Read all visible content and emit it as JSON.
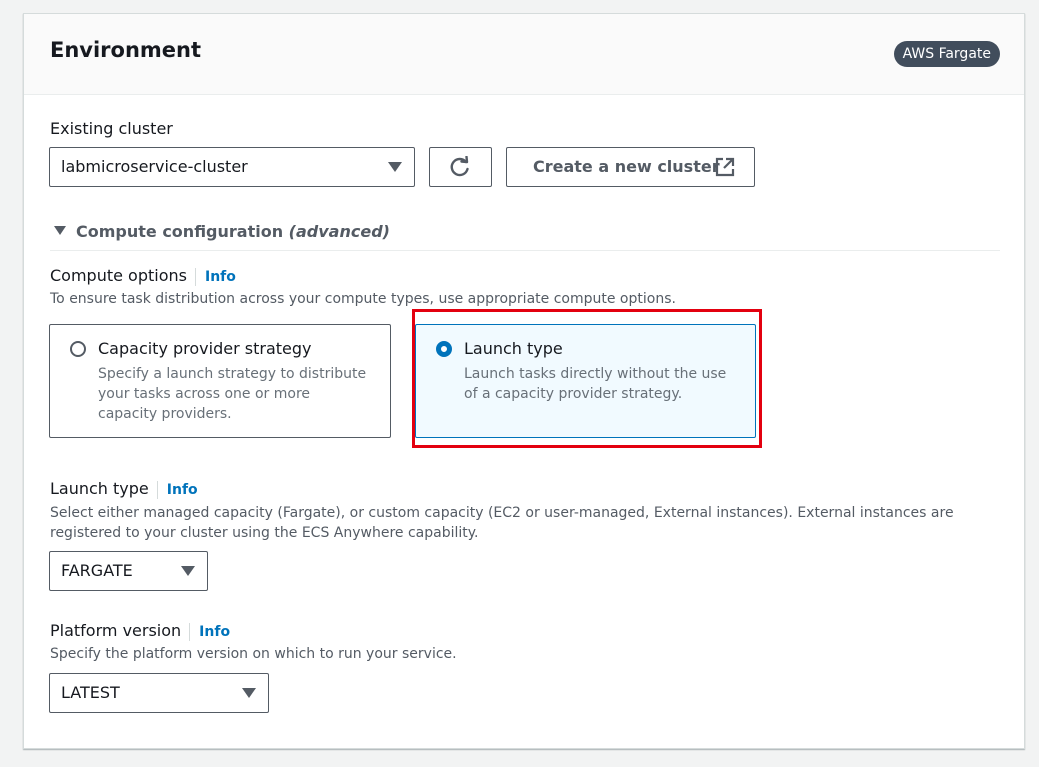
{
  "section": {
    "title": "Environment",
    "badge": "AWS Fargate"
  },
  "existing_cluster": {
    "label": "Existing cluster",
    "value": "labmicroservice-cluster",
    "create_button": "Create a new cluster"
  },
  "compute_configuration": {
    "title": "Compute configuration",
    "title_suffix": "(advanced)"
  },
  "compute_options": {
    "label": "Compute options",
    "info": "Info",
    "description": "To ensure task distribution across your compute types, use appropriate compute options.",
    "tiles": [
      {
        "label": "Capacity provider strategy",
        "description": "Specify a launch strategy to distribute your tasks across one or more capacity providers.",
        "selected": false
      },
      {
        "label": "Launch type",
        "description": "Launch tasks directly without the use of a capacity provider strategy.",
        "selected": true
      }
    ]
  },
  "launch_type": {
    "label": "Launch type",
    "info": "Info",
    "description": "Select either managed capacity (Fargate), or custom capacity (EC2 or user-managed, External instances). External instances are registered to your cluster using the ECS Anywhere capability.",
    "value": "FARGATE"
  },
  "platform_version": {
    "label": "Platform version",
    "info": "Info",
    "description": "Specify the platform version on which to run your service.",
    "value": "LATEST"
  },
  "colors": {
    "link": "#0073bb",
    "highlight": "#e3000f",
    "selected_bg": "#f1faff"
  },
  "icons": {
    "refresh": "refresh-icon",
    "external": "external-link-icon",
    "caret": "caret-down-icon"
  }
}
